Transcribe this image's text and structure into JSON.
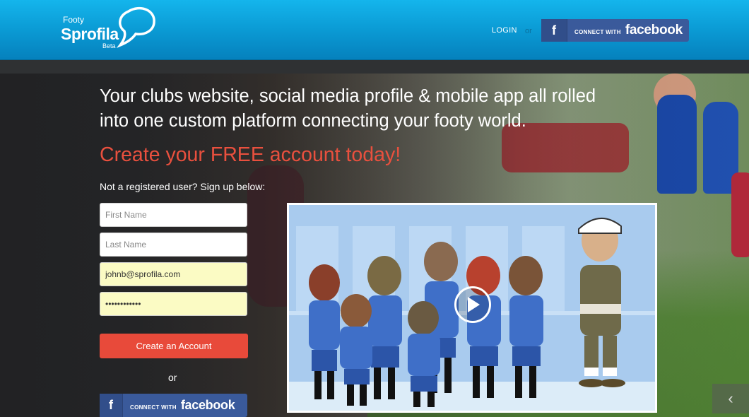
{
  "header": {
    "logo": {
      "line1": "Footy",
      "line2": "Sprofila",
      "line3": "Beta"
    },
    "login_label": "LOGIN",
    "or_label": "or",
    "facebook": {
      "icon": "f",
      "connect_label": "CONNECT WITH",
      "brand_label": "facebook"
    }
  },
  "hero": {
    "headline_line1": "Your clubs website, social media profile & mobile app all rolled",
    "headline_line2": "into one custom platform connecting your footy world.",
    "cta": "Create your FREE account today!",
    "signup_hint": "Not a registered user? Sign up below:"
  },
  "form": {
    "first_name": {
      "placeholder": "First Name",
      "value": ""
    },
    "last_name": {
      "placeholder": "Last Name",
      "value": ""
    },
    "email": {
      "value": "johnb@sprofila.com"
    },
    "password": {
      "value": "••••••••••••"
    },
    "submit_label": "Create an Account",
    "or_label": "or",
    "facebook": {
      "icon": "f",
      "connect_label": "CONNECT WITH",
      "brand_label": "facebook"
    }
  },
  "video": {
    "play_icon": "play-icon"
  },
  "carousel": {
    "prev_icon": "chevron-left-icon",
    "prev_glyph": "‹"
  },
  "colors": {
    "header_blue": "#0a98d2",
    "cta_red": "#e9503e",
    "button_red": "#e84a3a",
    "facebook_blue": "#3a5a9b",
    "autofill_yellow": "#fbfbc4"
  }
}
